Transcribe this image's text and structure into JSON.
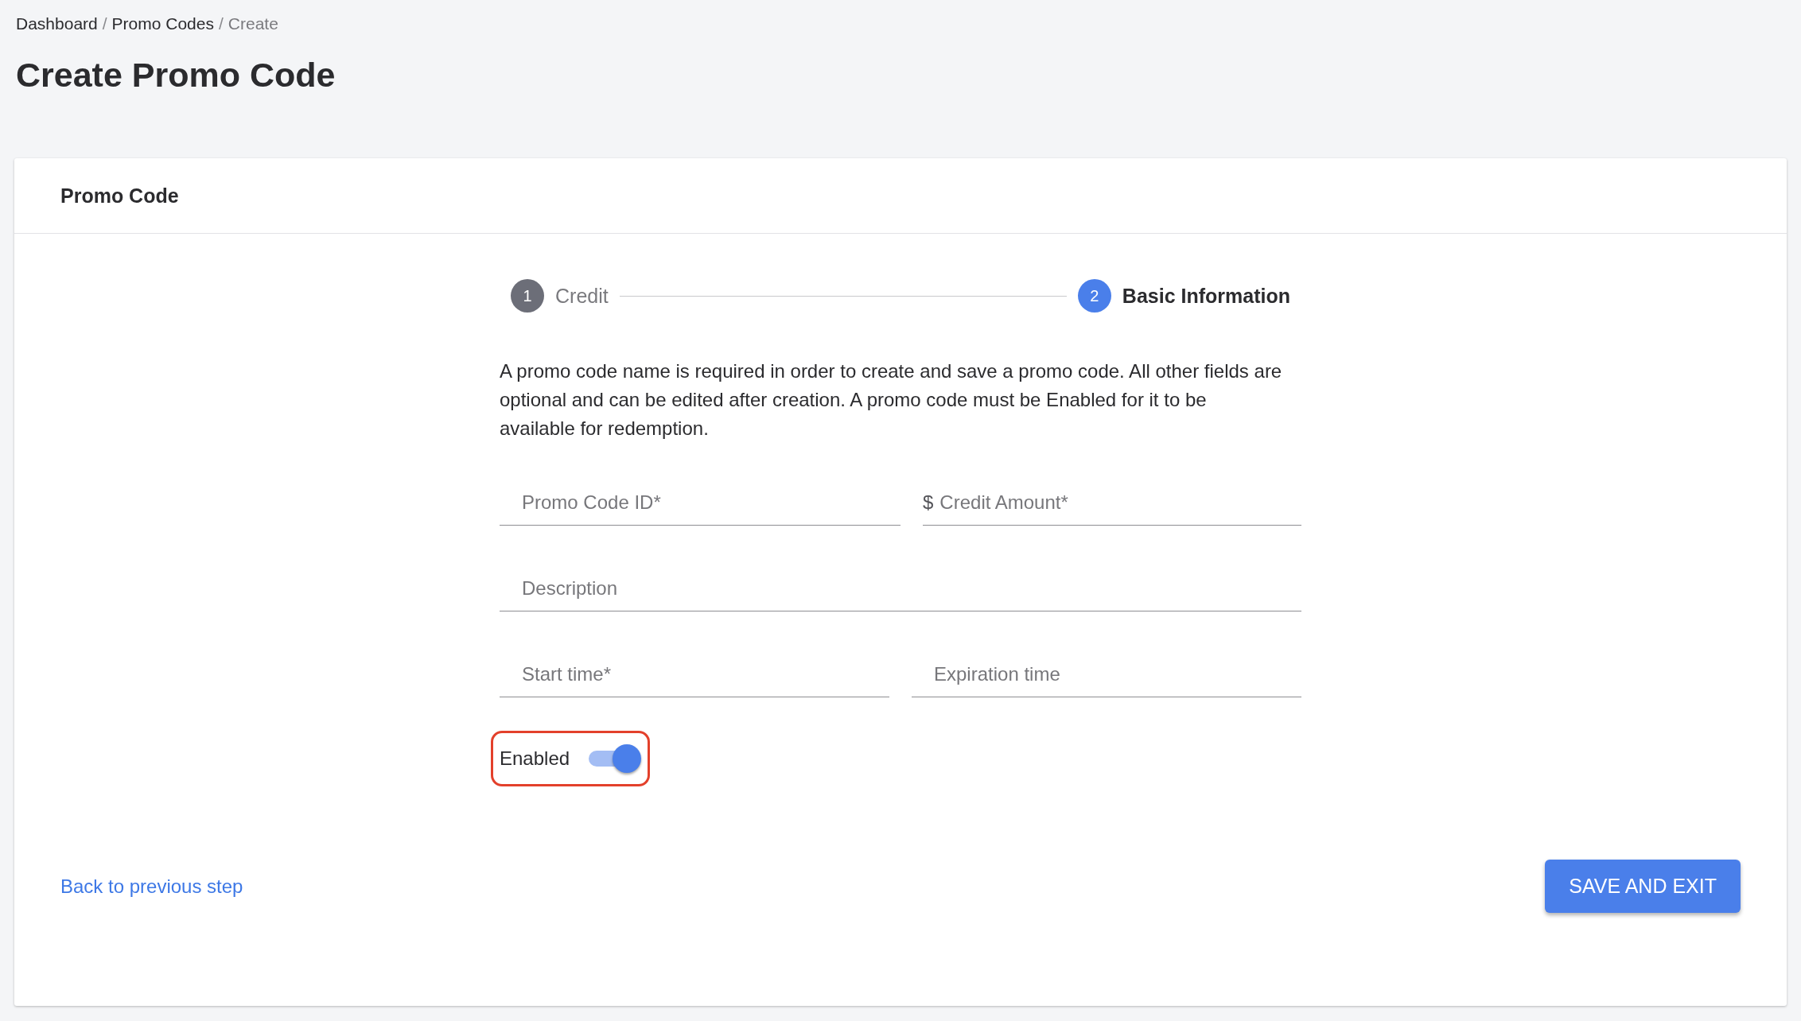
{
  "breadcrumb": [
    {
      "label": "Dashboard",
      "current": false
    },
    {
      "label": "Promo Codes",
      "current": false
    },
    {
      "label": "Create",
      "current": true
    }
  ],
  "separator": "/",
  "page_title": "Create Promo Code",
  "card": {
    "title": "Promo Code"
  },
  "steps": [
    {
      "number": "1",
      "label": "Credit",
      "selected": false
    },
    {
      "number": "2",
      "label": "Basic Information",
      "selected": true
    }
  ],
  "intro": "A promo code name is required in order to create and save a promo code. All other fields are optional and can be edited after creation. A promo code must be Enabled for it to be available for redemption.",
  "field_rows": [
    {
      "fields": [
        {
          "placeholder": "Promo Code ID*"
        },
        {
          "prefix": "$",
          "placeholder": "Credit Amount*"
        }
      ]
    },
    {
      "fields": [
        {
          "placeholder": "Description"
        }
      ]
    },
    {
      "fields": [
        {
          "placeholder": "Start time*"
        },
        {
          "placeholder": "Expiration time"
        }
      ]
    }
  ],
  "toggle": {
    "label": "Enabled",
    "on": true,
    "highlighted": true
  },
  "back_link": "Back to previous step",
  "save_button": "SAVE AND EXIT"
}
